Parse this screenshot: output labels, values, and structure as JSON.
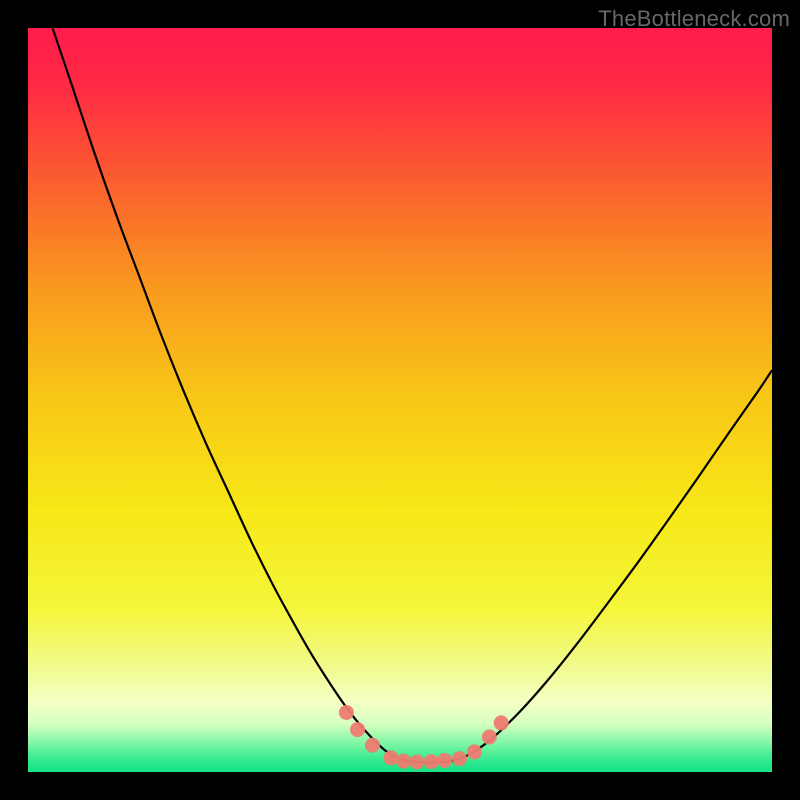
{
  "watermark": "TheBottleneck.com",
  "chart_data": {
    "type": "line",
    "title": "",
    "xlabel": "",
    "ylabel": "",
    "xlim": [
      0,
      100
    ],
    "ylim": [
      0,
      100
    ],
    "grid": false,
    "background_gradient": {
      "stops": [
        {
          "offset": 0,
          "color": "#ff1c4b"
        },
        {
          "offset": 0.08,
          "color": "#ff2a44"
        },
        {
          "offset": 0.2,
          "color": "#fb5c2f"
        },
        {
          "offset": 0.35,
          "color": "#f99a1f"
        },
        {
          "offset": 0.5,
          "color": "#f8c816"
        },
        {
          "offset": 0.65,
          "color": "#f7e817"
        },
        {
          "offset": 0.78,
          "color": "#f4f63a"
        },
        {
          "offset": 0.86,
          "color": "#f1fb8e"
        },
        {
          "offset": 0.905,
          "color": "#f5ffc4"
        },
        {
          "offset": 0.935,
          "color": "#d6ffc0"
        },
        {
          "offset": 0.96,
          "color": "#84f7a7"
        },
        {
          "offset": 0.985,
          "color": "#2fe98e"
        },
        {
          "offset": 1.0,
          "color": "#17e284"
        }
      ]
    },
    "series": [
      {
        "name": "curve",
        "stroke": "#000000",
        "stroke_width": 2.2,
        "x": [
          3.3,
          6,
          9,
          12,
          15,
          18,
          21,
          24,
          27,
          30,
          33,
          36,
          38,
          40,
          42,
          44,
          46,
          48,
          49.5,
          51,
          53,
          55,
          57,
          59,
          62,
          66,
          70,
          74,
          78,
          82,
          86,
          90,
          94,
          98,
          100
        ],
        "y": [
          100,
          92,
          83,
          74.5,
          66.5,
          58.5,
          51,
          44,
          37.5,
          31,
          25,
          19.5,
          16,
          12.8,
          9.8,
          7.1,
          4.8,
          2.9,
          2.0,
          1.5,
          1.3,
          1.3,
          1.5,
          2.2,
          4.2,
          8.0,
          12.5,
          17.5,
          22.8,
          28.2,
          33.8,
          39.5,
          45.3,
          51.0,
          54.0
        ]
      }
    ],
    "markers": {
      "name": "coral-dots",
      "fill": "#ee7c71",
      "fill_opacity": 0.95,
      "r": 7.5,
      "points": [
        {
          "x": 42.8,
          "y": 8.0
        },
        {
          "x": 44.3,
          "y": 5.7
        },
        {
          "x": 46.3,
          "y": 3.6
        },
        {
          "x": 48.8,
          "y": 1.9
        },
        {
          "x": 50.5,
          "y": 1.45
        },
        {
          "x": 52.3,
          "y": 1.35
        },
        {
          "x": 54.2,
          "y": 1.4
        },
        {
          "x": 56.0,
          "y": 1.55
        },
        {
          "x": 58.0,
          "y": 1.8
        },
        {
          "x": 60.0,
          "y": 2.7
        },
        {
          "x": 62.0,
          "y": 4.7
        },
        {
          "x": 63.6,
          "y": 6.6
        }
      ]
    }
  }
}
